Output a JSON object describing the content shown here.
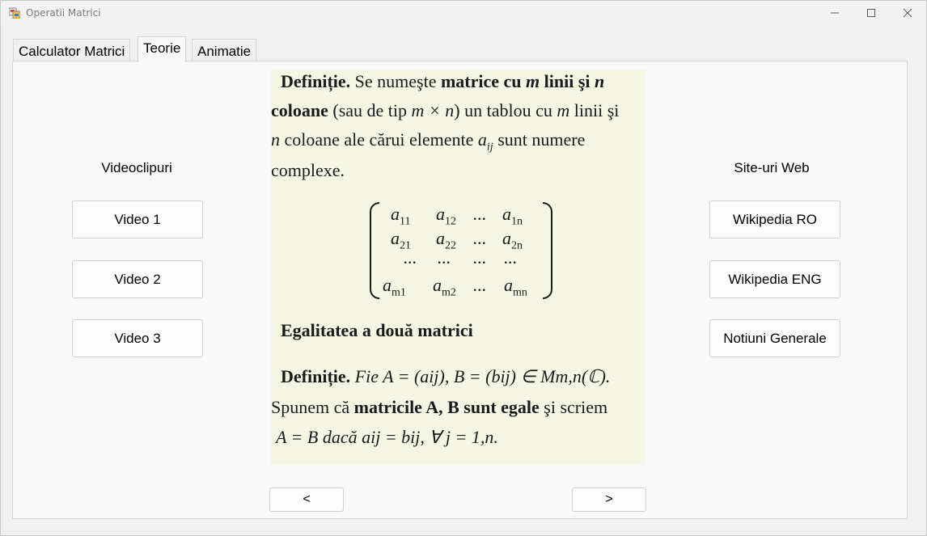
{
  "window": {
    "title": "Operatii Matrici"
  },
  "tabs": [
    {
      "label": "Calculator Matrici"
    },
    {
      "label": "Teorie"
    },
    {
      "label": "Animatie"
    }
  ],
  "left": {
    "heading": "Videoclipuri",
    "buttons": [
      "Video 1",
      "Video 2",
      "Video 3"
    ]
  },
  "right": {
    "heading": "Site-uri Web",
    "buttons": [
      "Wikipedia RO",
      "Wikipedia ENG",
      "Notiuni Generale"
    ]
  },
  "nav": {
    "prev": "<",
    "next": ">"
  },
  "theory": {
    "def_label": "Definiție.",
    "line1_a": "Se numeşte",
    "line1_b": "matrice cu",
    "m": "m",
    "linii_si": "linii şi",
    "n": "n",
    "coloane": "coloane",
    "line2_a": "(sau de tip",
    "mxn": "m × n",
    "line2_b": ") un tablou cu",
    "line2_c": "linii şi",
    "line3_a": "coloane ale cărui elemente",
    "aij": "a",
    "ij": "ij",
    "line3_b": "sunt numere",
    "line4": "complexe.",
    "matrix_rows": [
      [
        "a11",
        "a12",
        "...",
        "a1n"
      ],
      [
        "a21",
        "a22",
        "...",
        "a2n"
      ],
      [
        "...",
        "...",
        "...",
        "..."
      ],
      [
        "am1",
        "am2",
        "...",
        "amn"
      ]
    ],
    "heading2": "Egalitatea a două matrici",
    "def2_label": "Definiție.",
    "def2_text": "Fie A = (aij), B = (bij) ∈ Mm,n(ℂ).",
    "line6_a": "Spunem că",
    "line6_b": "matricile A, B sunt egale",
    "line6_c": "şi scriem",
    "line7": "A = B dacă aij = bij, ∀ j = 1,n."
  }
}
